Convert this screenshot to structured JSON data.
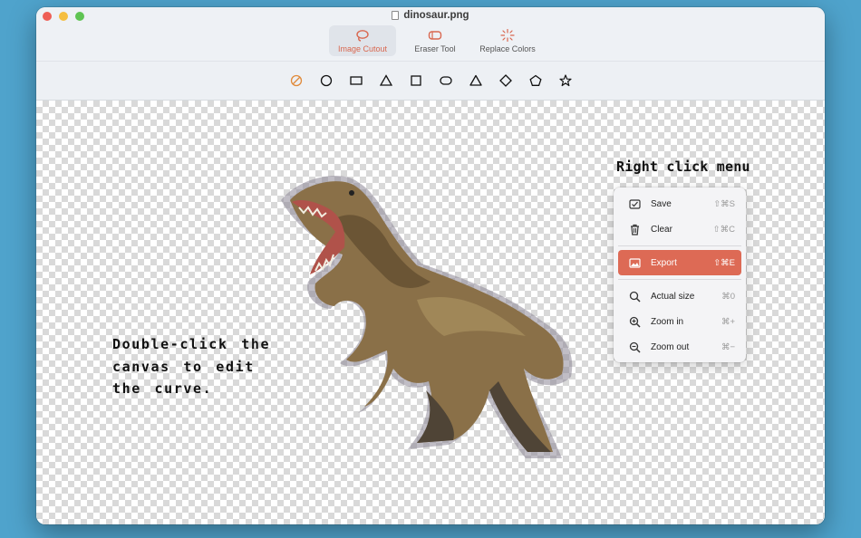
{
  "window": {
    "title": "dinosaur.png"
  },
  "tabs": [
    {
      "label": "Image Cutout",
      "icon": "lasso-icon",
      "active": true
    },
    {
      "label": "Eraser Tool",
      "icon": "eraser-icon",
      "active": false
    },
    {
      "label": "Replace Colors",
      "icon": "sparkle-icon",
      "active": false
    }
  ],
  "shape_tools": [
    "freehand-icon",
    "circle-icon",
    "rectangle-icon",
    "triangle-icon",
    "square-icon",
    "rounded-rectangle-icon",
    "triangle-icon",
    "diamond-icon",
    "pentagon-icon",
    "star-icon"
  ],
  "canvas": {
    "hint": "Double-click the canvas to edit the curve.",
    "menu_title": "Right click menu"
  },
  "context_menu": {
    "items": [
      {
        "label": "Save",
        "shortcut": "⇧⌘S",
        "icon": "checkbox-icon"
      },
      {
        "label": "Clear",
        "shortcut": "⇧⌘C",
        "icon": "trash-icon"
      },
      {
        "label": "Export",
        "shortcut": "⇧⌘E",
        "icon": "image-icon",
        "highlighted": true
      },
      {
        "label": "Actual size",
        "shortcut": "⌘0",
        "icon": "zoom-icon"
      },
      {
        "label": "Zoom in",
        "shortcut": "⌘+",
        "icon": "zoom-in-icon"
      },
      {
        "label": "Zoom out",
        "shortcut": "⌘−",
        "icon": "zoom-out-icon"
      }
    ]
  },
  "colors": {
    "accent": "#dd6a55",
    "background": "#4fa3cc"
  }
}
